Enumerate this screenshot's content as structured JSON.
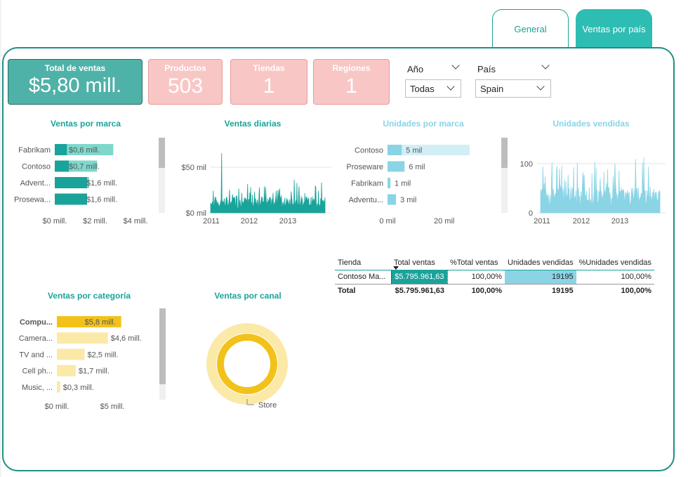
{
  "tabs": [
    {
      "label": "General"
    },
    {
      "label": "Ventas por país"
    }
  ],
  "kpis": {
    "total": {
      "title": "Total de ventas",
      "value": "$5,80 mill."
    },
    "productos": {
      "title": "Productos",
      "value": "503"
    },
    "tiendas": {
      "title": "Tiendas",
      "value": "1"
    },
    "regiones": {
      "title": "Regiones",
      "value": "1"
    }
  },
  "slicers": {
    "anio": {
      "label": "Año",
      "value": "Todas"
    },
    "pais": {
      "label": "País",
      "value": "Spain"
    }
  },
  "colors": {
    "teal": "#1aa39a",
    "teal_light": "#7fd8cc",
    "sky": "#8ad4e6",
    "gold": "#f2c21b",
    "gold_light": "#fbe9a8",
    "pink": "#f9c6c6"
  },
  "chart_data": [
    {
      "type": "bar",
      "title": "Ventas por marca",
      "categories": [
        "Fabrikam",
        "Contoso",
        "Advent...",
        "Prosewa..."
      ],
      "values": [
        0.6,
        0.7,
        1.6,
        1.6
      ],
      "data_labels": [
        "$0,6 mill.",
        "$0,7 mill.",
        "$1,6 mill.",
        "$1,6 mill."
      ],
      "x_ticks": [
        "$0 mill.",
        "$2 mill.",
        "$4 mill."
      ],
      "xlim": [
        0,
        4
      ]
    },
    {
      "type": "area",
      "title": "Ventas diarias",
      "x_ticks": [
        "2011",
        "2012",
        "2013"
      ],
      "y_ticks": [
        "$0 mil",
        "$50 mil"
      ],
      "ylim": [
        0,
        60000
      ]
    },
    {
      "type": "bar",
      "title": "Unidades por marca",
      "categories": [
        "Contoso",
        "Proseware",
        "Fabrikam",
        "Adventu..."
      ],
      "values": [
        5,
        6,
        1,
        3
      ],
      "data_labels": [
        "5 mil",
        "6 mil",
        "1 mil",
        "3 mil"
      ],
      "x_ticks": [
        "0 mil",
        "20 mil"
      ],
      "xlim": [
        0,
        30
      ]
    },
    {
      "type": "area",
      "title": "Unidades vendidas",
      "x_ticks": [
        "2011",
        "2012",
        "2013"
      ],
      "y_ticks": [
        "0",
        "100"
      ],
      "ylim": [
        0,
        120
      ]
    },
    {
      "type": "bar",
      "title": "Ventas por categoría",
      "categories": [
        "Compu...",
        "Camera...",
        "TV and ...",
        "Cell ph...",
        "Music, ..."
      ],
      "values": [
        5.8,
        4.6,
        2.5,
        1.7,
        0.3
      ],
      "data_labels": [
        "$5,8 mill.",
        "$4,6 mill.",
        "$2,5 mill.",
        "$1,7 mill.",
        "$0,3 mill."
      ],
      "x_ticks": [
        "$0 mill.",
        "$5 mill."
      ],
      "xlim": [
        0,
        6.2
      ]
    },
    {
      "type": "pie",
      "title": "Ventas por canal",
      "categories": [
        "Store"
      ],
      "values": [
        100
      ]
    }
  ],
  "table": {
    "headers": [
      "Tienda",
      "Total ventas",
      "%Total ventas",
      "Unidades vendidas",
      "%Unidades vendidas"
    ],
    "rows": [
      [
        "Contoso Ma...",
        "$5.795.961,63",
        "100,00%",
        "19195",
        "100,00%"
      ]
    ],
    "total": [
      "Total",
      "$5.795.961,63",
      "100,00%",
      "19195",
      "100,00%"
    ]
  }
}
